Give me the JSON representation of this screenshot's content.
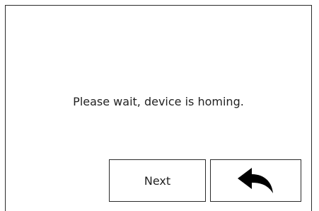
{
  "dialog": {
    "message": "Please wait, device is homing."
  },
  "buttons": {
    "next_label": "Next",
    "back_icon": "undo-arrow-icon"
  },
  "colors": {
    "border": "#2a2a2a",
    "text": "#222222",
    "icon": "#000000",
    "background": "#ffffff"
  }
}
